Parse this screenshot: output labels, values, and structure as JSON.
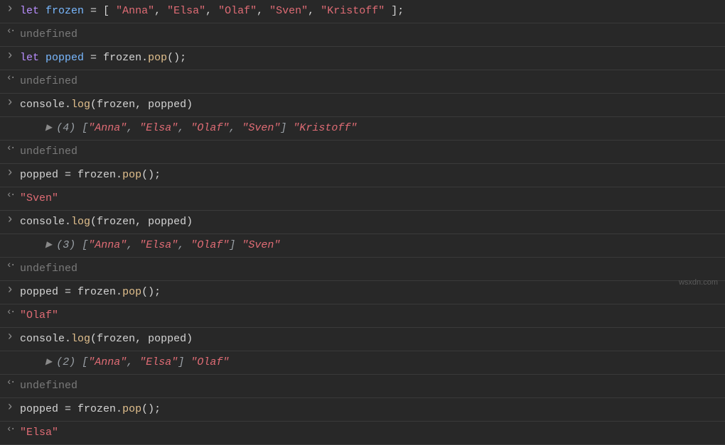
{
  "lines": {
    "l1": {
      "kw": "let",
      "var": "frozen",
      "eq": " = [ ",
      "s1": "\"Anna\"",
      "c": ", ",
      "s2": "\"Elsa\"",
      "s3": "\"Olaf\"",
      "s4": "\"Sven\"",
      "s5": "\"Kristoff\"",
      "end": " ];"
    },
    "undef": "undefined",
    "l2": {
      "kw": "let",
      "var": "popped",
      "eq": " = ",
      "obj": "frozen",
      "dot": ".",
      "fn": "pop",
      "call": "();"
    },
    "l3": {
      "obj": "console",
      "dot": ".",
      "fn": "log",
      "open": "(",
      "a1": "frozen",
      "c": ", ",
      "a2": "popped",
      "close": ")"
    },
    "log1": {
      "count": "(4)",
      "open": " [",
      "s1": "\"Anna\"",
      "c": ", ",
      "s2": "\"Elsa\"",
      "s3": "\"Olaf\"",
      "s4": "\"Sven\"",
      "close": "] ",
      "extra": "\"Kristoff\""
    },
    "l4": {
      "var": "popped",
      "eq": " = ",
      "obj": "frozen",
      "dot": ".",
      "fn": "pop",
      "call": "();"
    },
    "r4": "\"Sven\"",
    "log2": {
      "count": "(3)",
      "open": " [",
      "s1": "\"Anna\"",
      "c": ", ",
      "s2": "\"Elsa\"",
      "s3": "\"Olaf\"",
      "close": "] ",
      "extra": "\"Sven\""
    },
    "r5": "\"Olaf\"",
    "log3": {
      "count": "(2)",
      "open": " [",
      "s1": "\"Anna\"",
      "c": ", ",
      "s2": "\"Elsa\"",
      "close": "] ",
      "extra": "\"Olaf\""
    },
    "r6": "\"Elsa\""
  },
  "watermark": "wsxdn.com"
}
